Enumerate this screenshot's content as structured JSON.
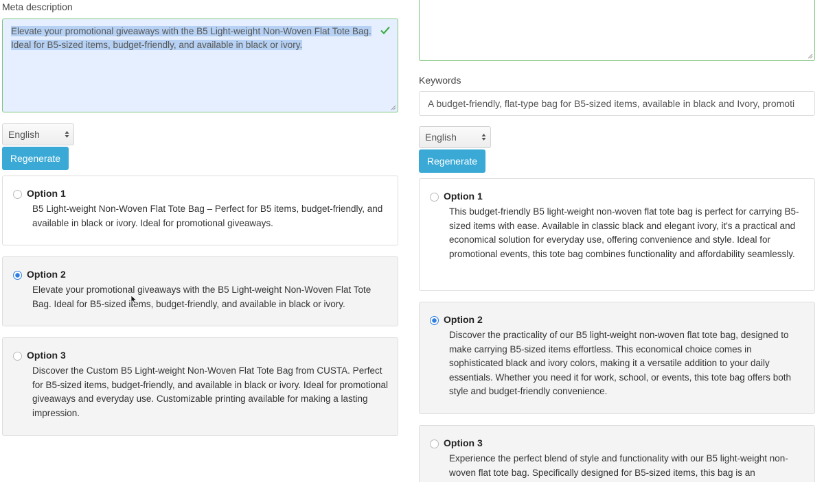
{
  "left": {
    "meta_label": "Meta description",
    "meta_value": "Elevate your promotional giveaways with the B5 Light-weight Non-Woven Flat Tote Bag. Ideal for B5-sized items, budget-friendly, and available in black or ivory.",
    "language": "English",
    "regenerate_label": "Regenerate",
    "options": [
      {
        "title": "Option 1",
        "text": "B5 Light-weight Non-Woven Flat Tote Bag – Perfect for B5 items, budget-friendly, and available in black or ivory. Ideal for promotional giveaways.",
        "selected": false
      },
      {
        "title": "Option 2",
        "text": "Elevate your promotional giveaways with the B5 Light-weight Non-Woven Flat Tote Bag. Ideal for B5-sized items, budget-friendly, and available in black or ivory.",
        "selected": true
      },
      {
        "title": "Option 3",
        "text": "Discover the Custom B5 Light-weight Non-Woven Flat Tote Bag from CUSTA. Perfect for B5-sized items, budget-friendly, and available in black or ivory. Ideal for promotional giveaways and everyday use. Customizable printing available for making a lasting impression.",
        "selected": false
      }
    ]
  },
  "right": {
    "keywords_label": "Keywords",
    "keywords_value": "A budget-friendly, flat-type bag for B5-sized items, available in black and Ivory, promoti",
    "language": "English",
    "regenerate_label": "Regenerate",
    "options": [
      {
        "title": "Option 1",
        "text": "This budget-friendly B5 light-weight non-woven flat tote bag is perfect for carrying B5-sized items with ease. Available in classic black and elegant ivory, it's a practical and economical solution for everyday use, offering convenience and style. Ideal for promotional events, this tote bag combines functionality and affordability seamlessly.",
        "selected": false
      },
      {
        "title": "Option 2",
        "text": "Discover the practicality of our B5 light-weight non-woven flat tote bag, designed to make carrying B5-sized items effortless. This economical choice comes in sophisticated black and ivory colors, making it a versatile addition to your daily essentials. Whether you need it for work, school, or events, this tote bag offers both style and budget-friendly convenience.",
        "selected": true
      },
      {
        "title": "Option 3",
        "text": "Experience the perfect blend of style and functionality with our B5 light-weight non-woven flat tote bag. Specifically designed for B5-sized items, this bag is an",
        "selected": false
      }
    ]
  },
  "colors": {
    "accent": "#3aa9d6",
    "valid_border": "#7cc47c",
    "radio_checked": "#2f7ee0",
    "selection": "#b6d1f3"
  },
  "icons": {
    "valid": "check-icon",
    "select": "updown-arrows-icon",
    "resize": "resize-grip-icon",
    "cursor": "mouse-cursor-icon"
  }
}
